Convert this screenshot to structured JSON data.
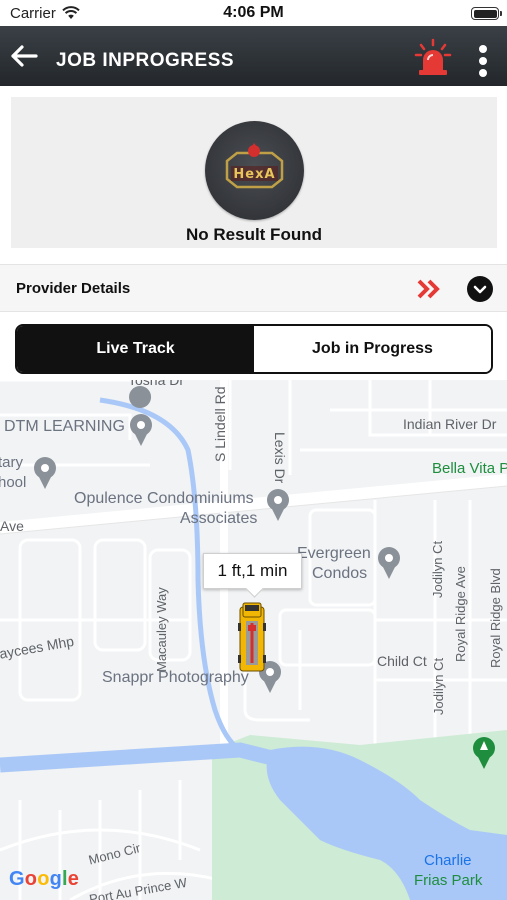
{
  "status_bar": {
    "carrier": "Carrier",
    "time": "4:06 PM",
    "icons": [
      "wifi-icon",
      "battery-icon"
    ]
  },
  "header": {
    "title": "JOB INPROGRESS",
    "icons": [
      "arrow-left-icon",
      "siren-icon",
      "more-vertical-icon"
    ]
  },
  "result": {
    "logo_text": "HexA",
    "message": "No Result Found"
  },
  "provider": {
    "label": "Provider Details",
    "icons": [
      "double-chevron-right-icon",
      "chevron-down-icon"
    ]
  },
  "tabs": [
    {
      "label": "Live Track",
      "active": true
    },
    {
      "label": "Job in Progress",
      "active": false
    }
  ],
  "map": {
    "labels": {
      "tosha_dr": "Tosha Dr",
      "s_lindell_rd": "S Lindell Rd",
      "lexis_dr": "Lexis Dr",
      "dtm_learning": "DTM LEARNING",
      "indian_river_dr": "Indian River Dr",
      "tary": "tary",
      "hool": "hool",
      "bella_vita": "Bella Vita P",
      "opulence_1": "Opulence Condominiums",
      "opulence_2": "Associates",
      "ave": "Ave",
      "evergreen_1": "Evergreen",
      "evergreen_2": "Condos",
      "jodilyn_ct_1": "Jodilyn Ct",
      "royal_ridge_ave": "Royal Ridge Ave",
      "royal_ridge_blvd": "Royal Ridge Blvd",
      "macauley_way": "Macauley Way",
      "aycees_mhp": "aycees Mhp",
      "child_ct": "Child Ct",
      "jodilyn_ct_2": "Jodilyn Ct",
      "snappr": "Snappr Photography",
      "mono_cir": "Mono Cir",
      "port_au_prince": "Port Au Prince W",
      "charlie_1": "Charlie",
      "charlie_2": "Frias Park",
      "google": "Google"
    },
    "eta": "1 ft,1 min",
    "colors": {
      "water": "#aac8f7",
      "park": "#cdebd5",
      "road": "#ffffff",
      "land": "#f1f3f4",
      "brand_red": "#e53935"
    }
  }
}
